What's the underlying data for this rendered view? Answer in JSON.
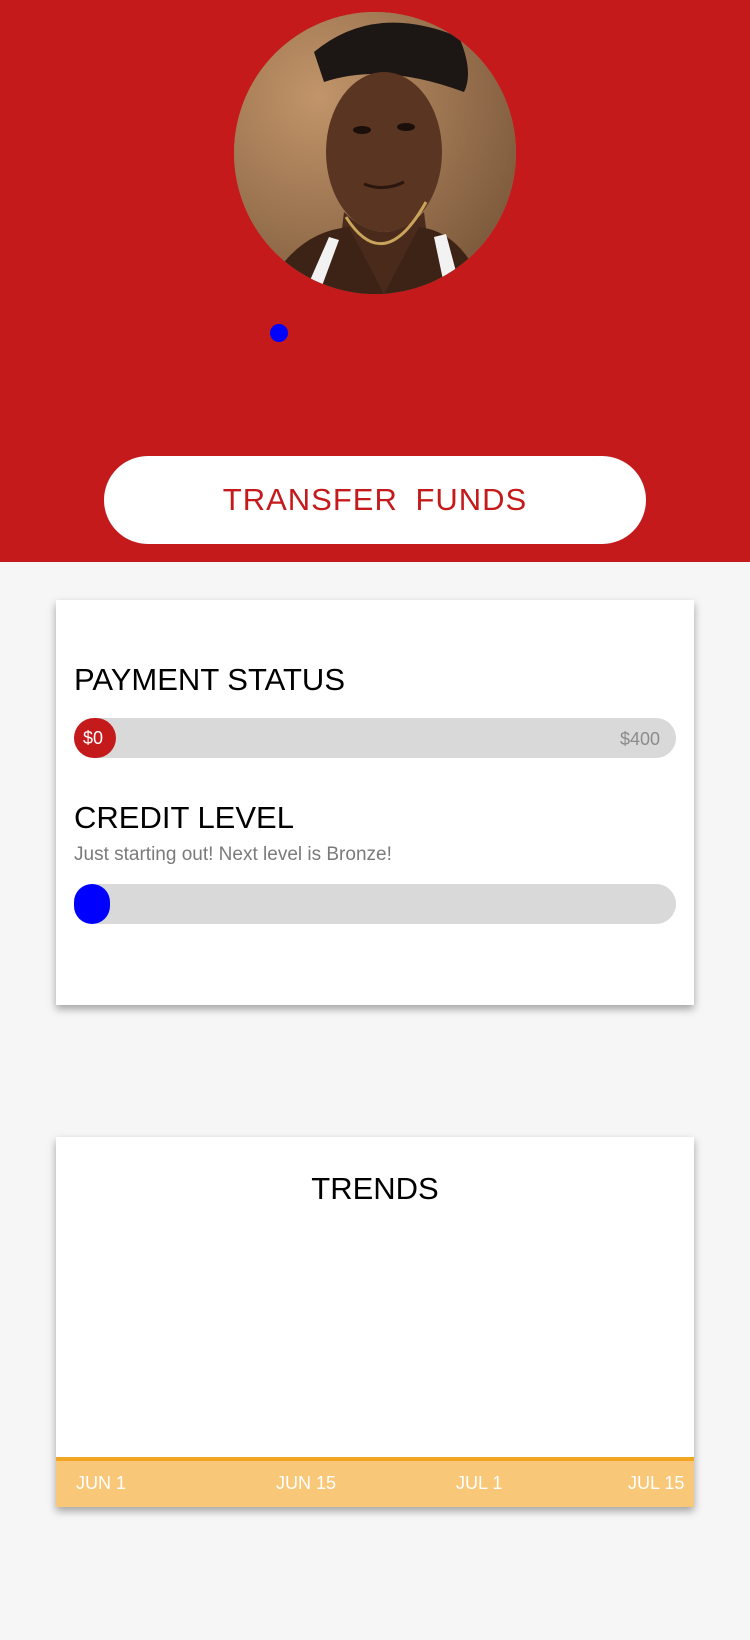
{
  "header": {
    "avatar_alt": "profile photo",
    "transfer_button_label": "TRANSFER  FUNDS"
  },
  "colors": {
    "brand_red": "#c41a1b",
    "knob_blue": "#0000ff",
    "track_gray": "#d9d9d9",
    "chart_orange": "#f0a623",
    "chart_fill": "#f8c878"
  },
  "payment_status": {
    "heading": "PAYMENT STATUS",
    "current_label": "$0",
    "max_label": "$400",
    "progress": 0
  },
  "credit_level": {
    "heading": "CREDIT LEVEL",
    "subtitle": "Just starting out! Next level is Bronze!",
    "progress": 0
  },
  "trends": {
    "heading": "TRENDS"
  },
  "chart_data": {
    "type": "area",
    "x": [
      "JUN 1",
      "JUN 15",
      "JUL 1",
      "JUL 15"
    ],
    "series": [],
    "title": "TRENDS",
    "xlabel": "",
    "ylabel": "",
    "grid": false
  }
}
